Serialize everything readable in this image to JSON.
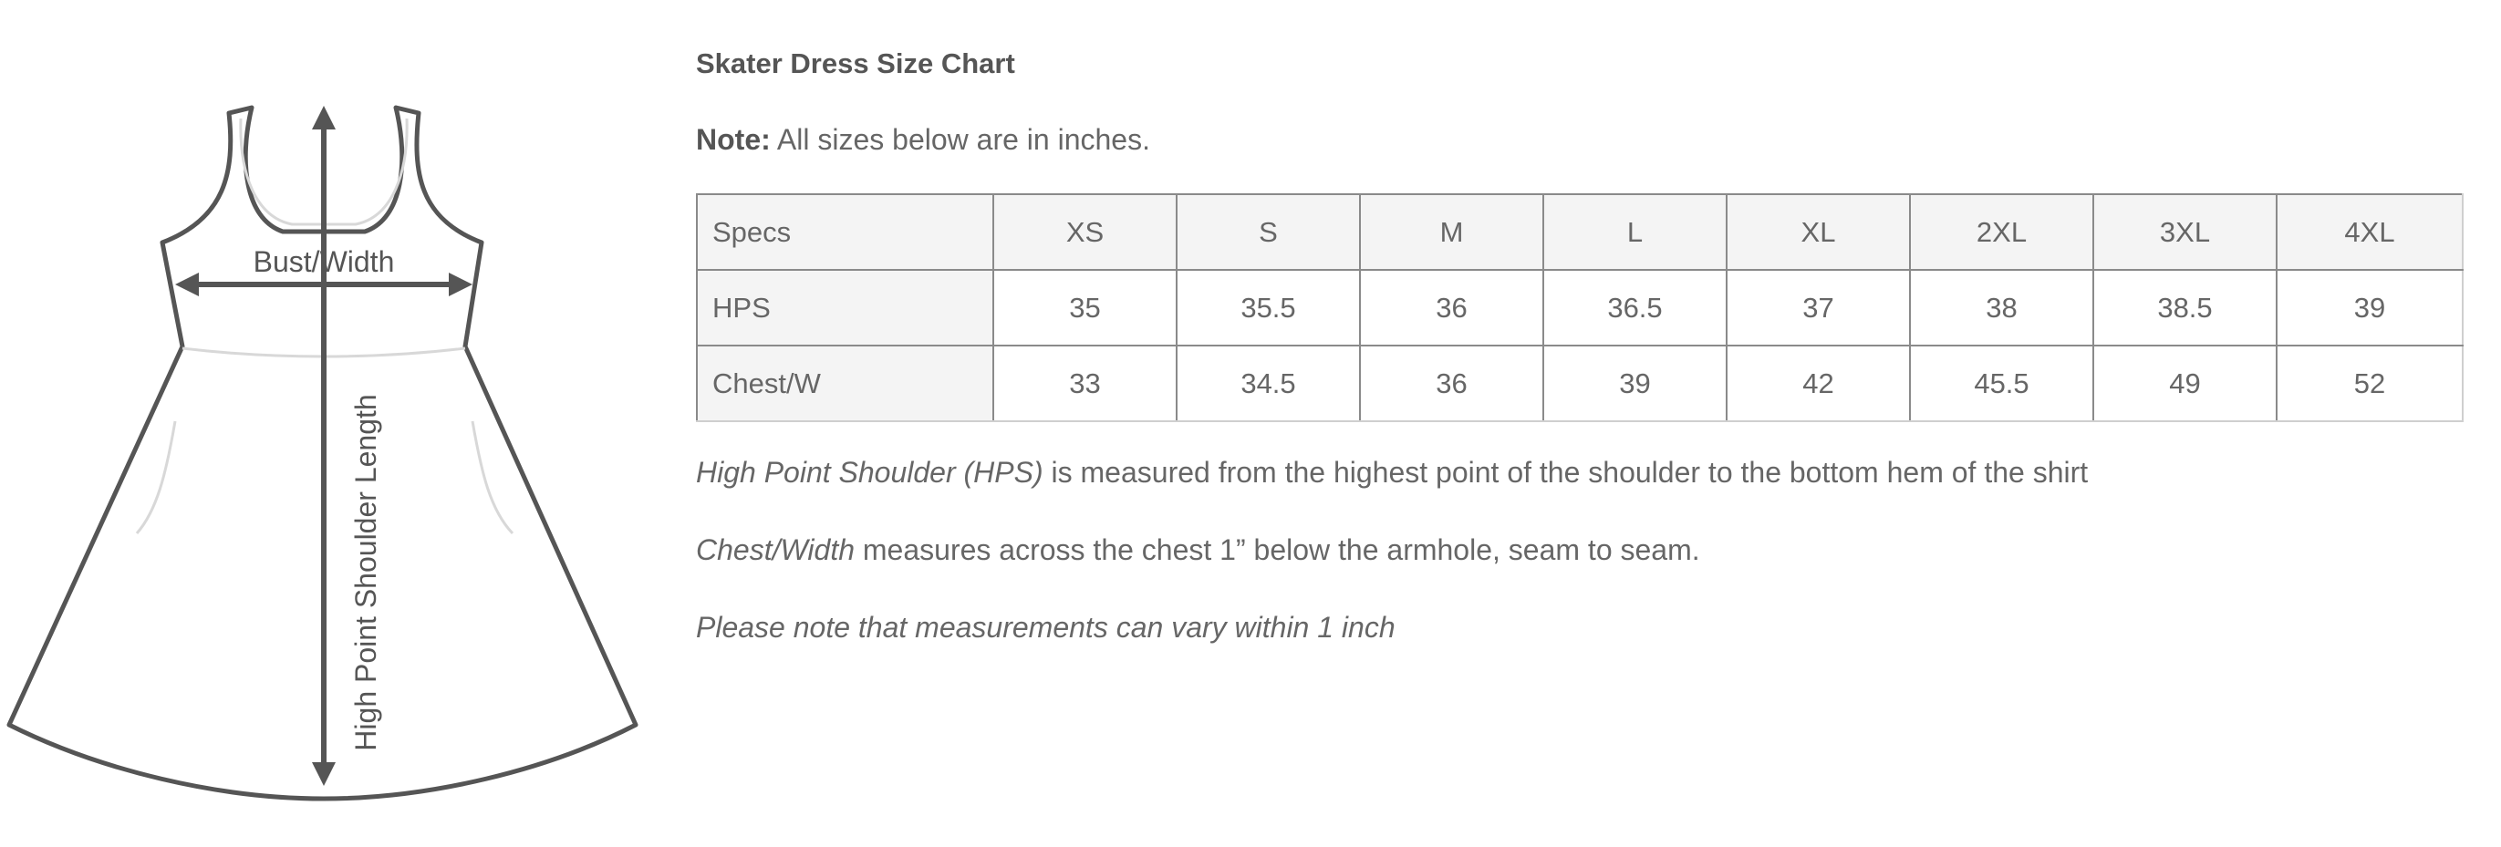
{
  "illustration": {
    "bust_label": "Bust/Width",
    "length_label": "High Point Shoulder Length"
  },
  "title": "Skater Dress Size Chart",
  "note": {
    "label": "Note:",
    "text": " All sizes below are in inches."
  },
  "table": {
    "columns": [
      "Specs",
      "XS",
      "S",
      "M",
      "L",
      "XL",
      "2XL",
      "3XL",
      "4XL"
    ],
    "rows": [
      {
        "label": "HPS",
        "values": [
          "35",
          "35.5",
          "36",
          "36.5",
          "37",
          "38",
          "38.5",
          "39"
        ]
      },
      {
        "label": "Chest/W",
        "values": [
          "33",
          "34.5",
          "36",
          "39",
          "42",
          "45.5",
          "49",
          "52"
        ]
      }
    ]
  },
  "paragraphs": {
    "hps_term": "High Point Shoulder (HPS)",
    "hps_text": " is measured from the highest point of the shoulder to the bottom hem of the shirt",
    "chest_term": "Chest/Width",
    "chest_text": " measures across the chest 1” below the armhole, seam to seam.",
    "variance_note": "Please note that measurements can vary within 1 inch"
  }
}
